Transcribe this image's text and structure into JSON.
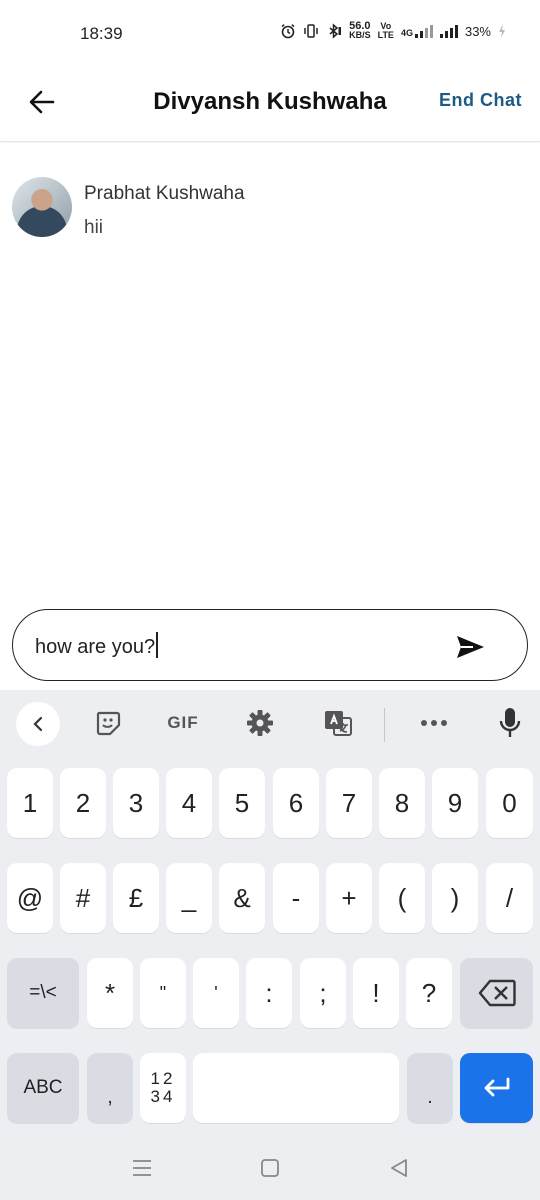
{
  "status_bar": {
    "time": "18:39",
    "net_speed_top": "56.0",
    "net_speed_bottom": "KB/S",
    "volte_top": "Vo",
    "volte_bottom": "LTE",
    "network": "4G",
    "battery": "33%"
  },
  "header": {
    "title": "Divyansh Kushwaha",
    "end_chat_label": "End Chat"
  },
  "messages": [
    {
      "sender": "Prabhat Kushwaha",
      "text": "hii"
    }
  ],
  "composer": {
    "value": "how are you?"
  },
  "keyboard": {
    "toolbar": {
      "gif_label": "GIF"
    },
    "row1": [
      "1",
      "2",
      "3",
      "4",
      "5",
      "6",
      "7",
      "8",
      "9",
      "0"
    ],
    "row2": [
      "@",
      "#",
      "£",
      "_",
      "&",
      "-",
      "+",
      "(",
      ")",
      "/"
    ],
    "row3": {
      "switch": "=\\<",
      "keys": [
        "*",
        "\"",
        "'",
        ":",
        ";",
        "!",
        "?"
      ]
    },
    "row4": {
      "abc": "ABC",
      "comma": ",",
      "numpad_top": "12",
      "numpad_bottom": "34",
      "period": "."
    }
  },
  "colors": {
    "accent": "#1f5a86",
    "enter_key": "#1a73e8",
    "keyboard_bg": "#eceef2"
  }
}
